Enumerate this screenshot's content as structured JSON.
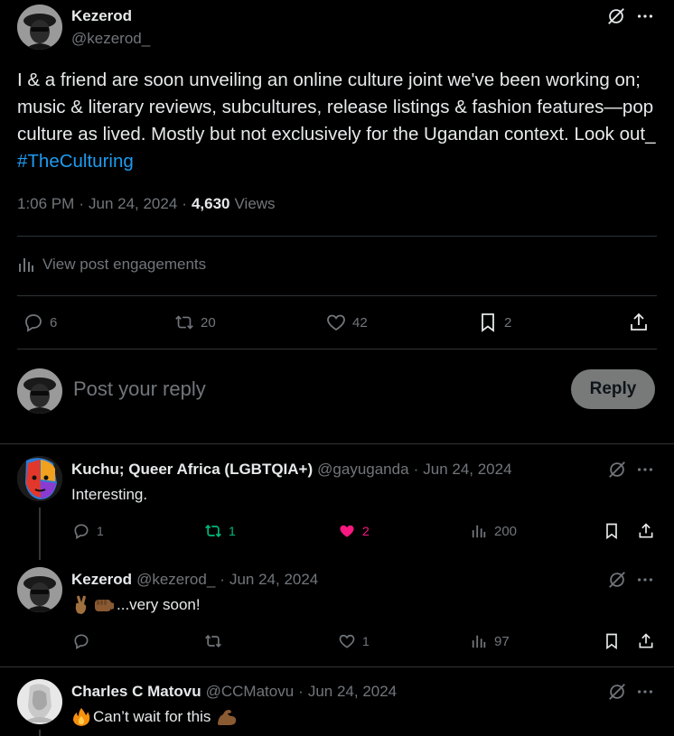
{
  "main_post": {
    "author_name": "Kezerod",
    "author_handle": "@kezerod_",
    "text_part1": "I & a friend are soon unveiling an online culture joint we've been working on; music & literary reviews, subcultures, release listings & fashion features—pop culture as lived. Mostly but not exclusively for the Ugandan context. Look out_ ",
    "hashtag": "#TheCulturing",
    "time": "1:06 PM",
    "date": "Jun 24, 2024",
    "views_count": "4,630",
    "views_label": "Views",
    "engagements_label": "View post engagements",
    "replies": "6",
    "reposts": "20",
    "likes": "42",
    "bookmarks": "2"
  },
  "reply_box": {
    "placeholder": "Post your reply",
    "button_label": "Reply"
  },
  "replies": [
    {
      "author_name": "Kuchu; Queer Africa (LGBTQIA+)",
      "author_handle": "@gayuganda",
      "date": "Jun 24, 2024",
      "text": "Interesting.",
      "replies": "1",
      "reposts": "1",
      "likes": "2",
      "views": "200"
    },
    {
      "author_name": "Kezerod",
      "author_handle": "@kezerod_",
      "date": "Jun 24, 2024",
      "text": "...very soon!",
      "replies": "",
      "reposts": "",
      "likes": "1",
      "views": "97"
    },
    {
      "author_name": "Charles C Matovu",
      "author_handle": "@CCMatovu",
      "date": "Jun 24, 2024",
      "text": "Can’t wait for this"
    }
  ],
  "colors": {
    "accent": "#1d9bf0",
    "repost_active": "#00ba7c",
    "like_active": "#f91880",
    "muted": "#71767b"
  }
}
